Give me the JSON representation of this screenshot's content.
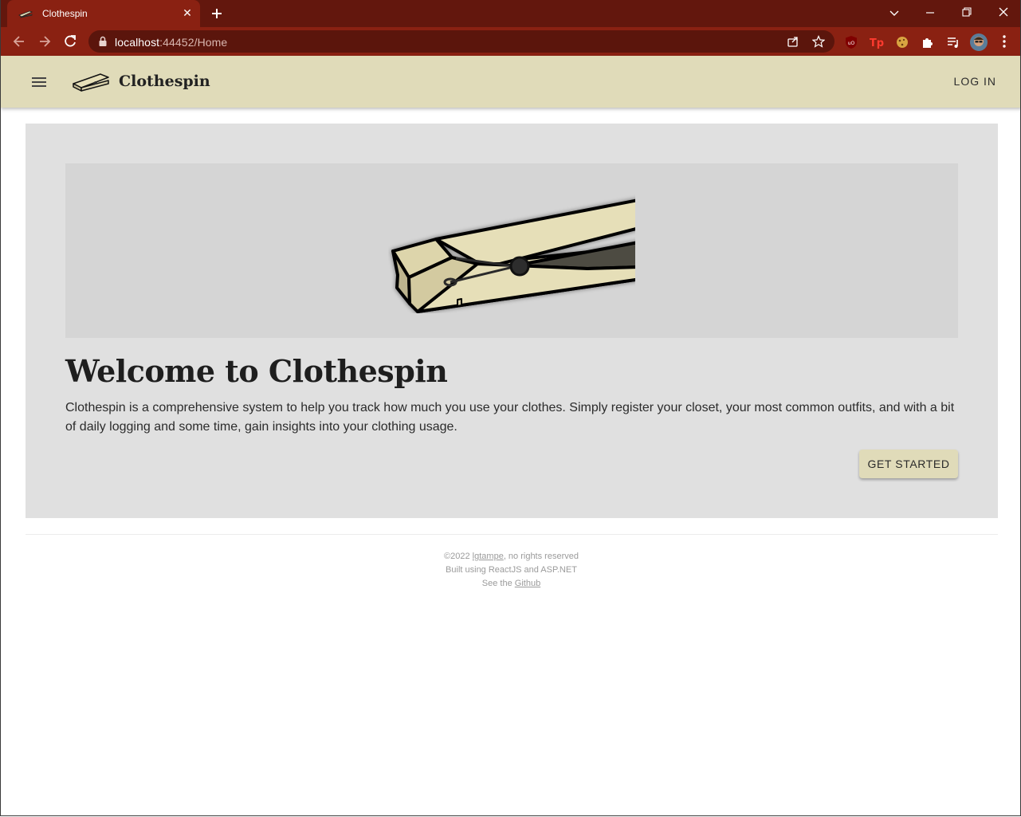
{
  "browser": {
    "tab_title": "Clothespin",
    "url_host": "localhost",
    "url_rest": ":44452/Home",
    "theme_color": "#8a2112"
  },
  "header": {
    "brand": "Clothespin",
    "login_label": "LOG IN",
    "background": "#e0dbb9"
  },
  "hero": {
    "title": "Welcome to Clothespin",
    "description": "Clothespin is a comprehensive system to help you track how much you use your clothes. Simply register your closet, your most common outfits, and with a bit of daily logging and some time, gain insights into your clothing usage.",
    "cta_label": "GET STARTED"
  },
  "footer": {
    "copyright_prefix": "©2022 ",
    "author_link": "lgtampe",
    "copyright_suffix": ", no rights reserved",
    "built_with": "Built using ReactJS and ASP.NET",
    "see_prefix": "See the ",
    "github_link": "Github"
  }
}
